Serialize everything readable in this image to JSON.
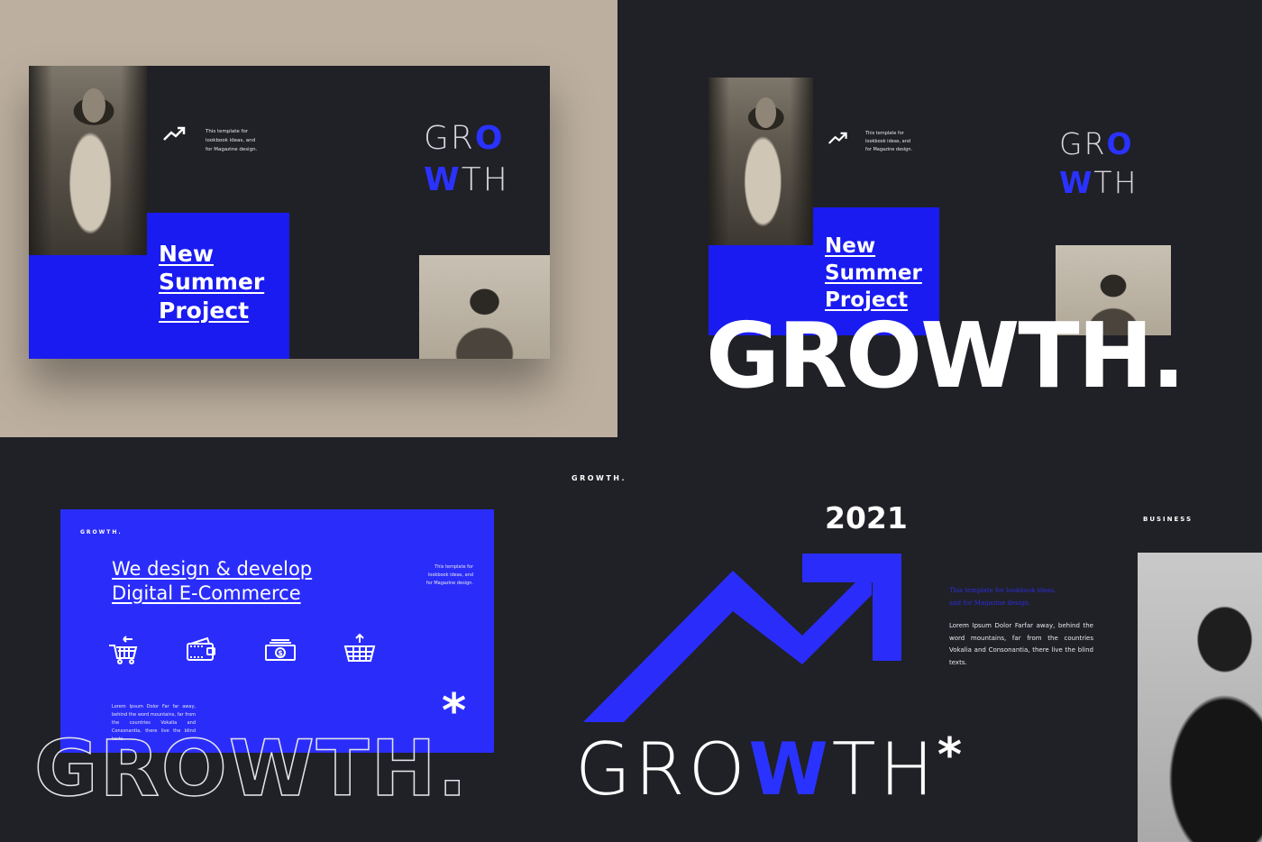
{
  "brand": {
    "accent_color": "#2a2dfa",
    "background_color": "#202027",
    "beige_color": "#bcaf9f"
  },
  "panel_top_left": {
    "icon": "trending-up-arrow-icon",
    "description": "This template for lookbook ideas, and for Magazine design.",
    "headline_lines": [
      "New",
      "Summer",
      "Project"
    ],
    "growth_stack": {
      "line1_plain": "GR",
      "line1_accent": "O",
      "line2_accent": "W",
      "line2_plain": "TH"
    }
  },
  "panel_top_right": {
    "icon": "trending-up-arrow-icon",
    "description": "This template for lookbook ideas, and for Magazine design.",
    "headline_lines": [
      "New",
      "Summer",
      "Project"
    ],
    "growth_stack": {
      "line1_plain": "GR",
      "line1_accent": "O",
      "line2_accent": "W",
      "line2_plain": "TH"
    },
    "big_title": "GROWTH."
  },
  "panel_bottom_left": {
    "brand_label": "GROWTH.",
    "headline_lines": [
      "We design & develop",
      "Digital E-Commerce"
    ],
    "side_note": "This template for lookbook ideas, and for Magazine design.",
    "icons": [
      {
        "name": "cart-remove-icon"
      },
      {
        "name": "wallet-icon"
      },
      {
        "name": "cash-icon"
      },
      {
        "name": "basket-upload-icon"
      }
    ],
    "body_text": "Lorem Ipsum Dolor Far far away, behind the word mountains, far from the countries Vokalia and Consonantia, there live the blind texts.",
    "asterisk": "*",
    "outline_title": "GROWTH."
  },
  "panel_bottom_right": {
    "brand_label": "GROWTH.",
    "year": "2021",
    "section_label": "BUSINESS",
    "blue_note_lines": [
      "This template for lookbook ideas,",
      "and for Magazine design."
    ],
    "body_text": "Lorem Ipsum Dolor Farfar away, behind the word mountains, far from the countries Vokalia and Consonantia, there live the blind texts.",
    "title": {
      "before": "GRO",
      "accent": "W",
      "after": "TH",
      "suffix": "*"
    }
  }
}
